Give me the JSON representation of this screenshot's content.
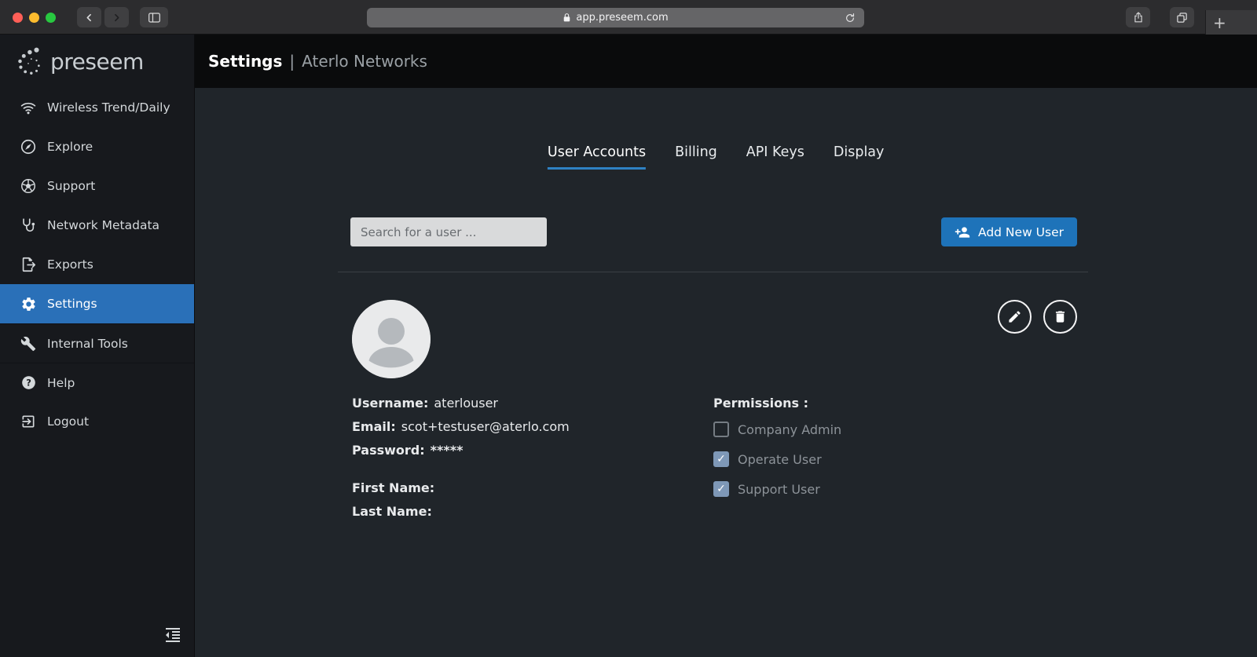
{
  "browser": {
    "url": "app.preseem.com",
    "icons": {
      "back": "chevron-left-icon",
      "forward": "chevron-right-icon",
      "sidebar_toggle": "sidebar-panel-icon",
      "lock": "lock-icon",
      "refresh": "refresh-icon",
      "share": "share-icon",
      "tab_overview": "tab-overview-icon",
      "new_tab": "+"
    }
  },
  "sidebar": {
    "logo_text": "preseem",
    "items": [
      {
        "label": "Wireless Trend/Daily",
        "icon": "wifi-icon",
        "active": false
      },
      {
        "label": "Explore",
        "icon": "explore-icon",
        "active": false
      },
      {
        "label": "Support",
        "icon": "support-ball-icon",
        "active": false
      },
      {
        "label": "Network Metadata",
        "icon": "stethoscope-icon",
        "active": false
      },
      {
        "label": "Exports",
        "icon": "export-file-icon",
        "active": false
      },
      {
        "label": "Settings",
        "icon": "gear-icon",
        "active": true
      },
      {
        "label": "Internal Tools",
        "icon": "wrench-icon",
        "active": false
      },
      {
        "label": "Help",
        "icon": "question-circle-icon",
        "active": false
      },
      {
        "label": "Logout",
        "icon": "logout-icon",
        "active": false
      }
    ]
  },
  "header": {
    "title": "Settings",
    "separator": "|",
    "subtitle": "Aterlo Networks"
  },
  "tabs": [
    {
      "label": "User Accounts",
      "active": true
    },
    {
      "label": "Billing",
      "active": false
    },
    {
      "label": "API Keys",
      "active": false
    },
    {
      "label": "Display",
      "active": false
    }
  ],
  "toolbar": {
    "search_placeholder": "Search for a user ...",
    "add_user_label": "Add New User"
  },
  "user_card": {
    "username_label": "Username:",
    "username": "aterlouser",
    "email_label": "Email:",
    "email": "scot+testuser@aterlo.com",
    "password_label": "Password:",
    "password_masked": "*****",
    "first_name_label": "First Name:",
    "first_name": "",
    "last_name_label": "Last Name:",
    "last_name": "",
    "permissions_label": "Permissions :",
    "permissions": [
      {
        "label": "Company Admin",
        "checked": false
      },
      {
        "label": "Operate User",
        "checked": true
      },
      {
        "label": "Support User",
        "checked": true
      }
    ]
  },
  "colors": {
    "accent_blue": "#1e73b9",
    "active_nav_blue": "#2a70b8",
    "tab_underline_blue": "#2f82c3",
    "checked_checkbox": "#7e98b7"
  }
}
